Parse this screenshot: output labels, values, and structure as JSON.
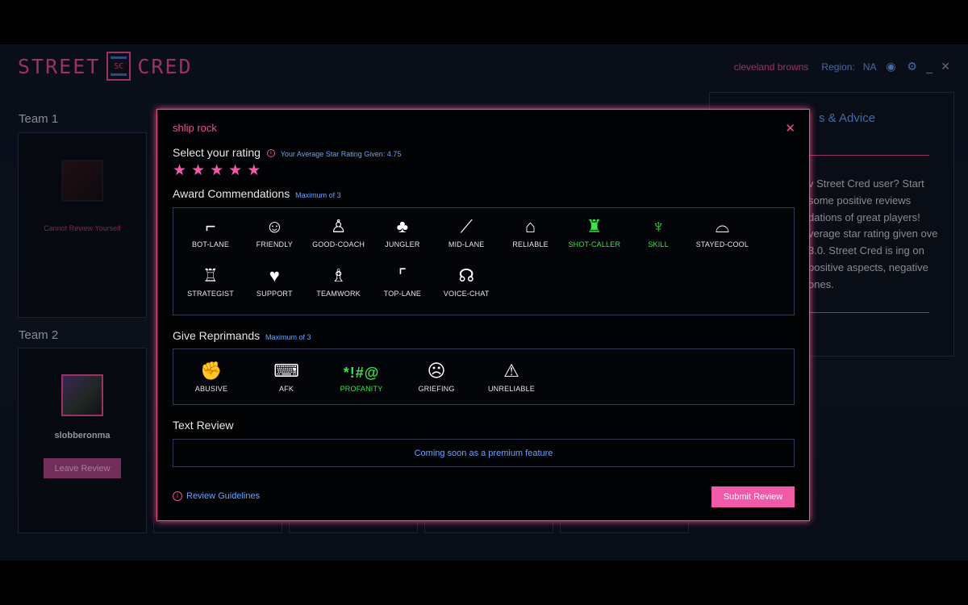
{
  "app": {
    "logo_left": "STREET",
    "logo_badge": "SC",
    "logo_right": "CRED",
    "user": "cleveland browns",
    "region_label": "Region:",
    "region_value": "NA"
  },
  "teams": {
    "team1_label": "Team 1",
    "team1_note": "Cannot Review Yourself",
    "team2_label": "Team 2",
    "team2_player": "slobberonma",
    "leave_review": "Leave Review"
  },
  "advice": {
    "title": "s & Advice",
    "body": "v Street Cred user? Start some positive reviews dations of great players! verage star rating given ove 3.0. Street Cred is ing on positive aspects, negative ones."
  },
  "modal": {
    "player_name": "shlip rock",
    "rating_title": "Select your rating",
    "avg_rating": "Your Average Star Rating Given: 4.75",
    "stars_selected": 5,
    "stars_total": 5,
    "commendations_title": "Award Commendations",
    "commendations_note": "Maximum of 3",
    "commendations": [
      {
        "label": "BOT-LANE",
        "icon": "bot-lane-icon",
        "glyph": "⌐",
        "selected": false
      },
      {
        "label": "FRIENDLY",
        "icon": "friendly-icon",
        "glyph": "☺",
        "selected": false
      },
      {
        "label": "GOOD-COACH",
        "icon": "good-coach-icon",
        "glyph": "♙",
        "selected": false
      },
      {
        "label": "JUNGLER",
        "icon": "jungler-icon",
        "glyph": "♣",
        "selected": false
      },
      {
        "label": "MID-LANE",
        "icon": "mid-lane-icon",
        "glyph": "⟋",
        "selected": false
      },
      {
        "label": "RELIABLE",
        "icon": "reliable-icon",
        "glyph": "⌂",
        "selected": false
      },
      {
        "label": "SHOT-CALLER",
        "icon": "shot-caller-icon",
        "glyph": "♜",
        "selected": true
      },
      {
        "label": "SKILL",
        "icon": "skill-icon",
        "glyph": "♆",
        "selected": true
      },
      {
        "label": "STAYED-COOL",
        "icon": "stayed-cool-icon",
        "glyph": "⌓",
        "selected": false
      },
      {
        "label": "STRATEGIST",
        "icon": "strategist-icon",
        "glyph": "♖",
        "selected": false
      },
      {
        "label": "SUPPORT",
        "icon": "support-icon",
        "glyph": "♥",
        "selected": false
      },
      {
        "label": "TEAMWORK",
        "icon": "teamwork-icon",
        "glyph": "♗",
        "selected": false
      },
      {
        "label": "TOP-LANE",
        "icon": "top-lane-icon",
        "glyph": "⌜",
        "selected": false
      },
      {
        "label": "VOICE-CHAT",
        "icon": "voice-chat-icon",
        "glyph": "☊",
        "selected": false
      }
    ],
    "reprimands_title": "Give Reprimands",
    "reprimands_note": "Maximum of 3",
    "reprimands": [
      {
        "label": "ABUSIVE",
        "icon": "abusive-icon",
        "glyph": "✊",
        "selected": false
      },
      {
        "label": "AFK",
        "icon": "afk-icon",
        "glyph": "⌨",
        "selected": false
      },
      {
        "label": "PROFANITY",
        "icon": "profanity-icon",
        "glyph": "*!#@",
        "selected": true
      },
      {
        "label": "GRIEFING",
        "icon": "griefing-icon",
        "glyph": "☹",
        "selected": false
      },
      {
        "label": "UNRELIABLE",
        "icon": "unreliable-icon",
        "glyph": "⚠",
        "selected": false
      }
    ],
    "text_review_title": "Text Review",
    "text_review_placeholder": "Coming soon as a premium feature",
    "guidelines": "Review Guidelines",
    "submit": "Submit Review"
  }
}
